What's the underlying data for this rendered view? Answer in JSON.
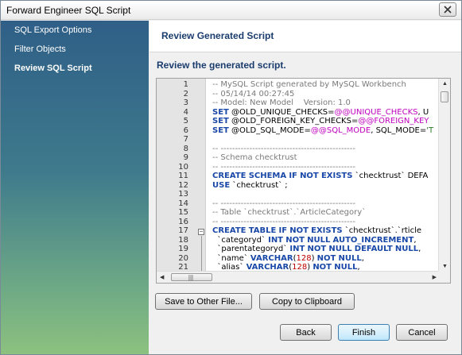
{
  "window": {
    "title": "Forward Engineer SQL Script"
  },
  "sidebar": {
    "items": [
      {
        "label": "SQL Export Options",
        "active": false
      },
      {
        "label": "Filter Objects",
        "active": false
      },
      {
        "label": "Review SQL Script",
        "active": true
      }
    ]
  },
  "main": {
    "page_title": "Review Generated Script",
    "subheading": "Review the generated script."
  },
  "editor": {
    "line_numbers": [
      "1",
      "2",
      "3",
      "4",
      "5",
      "6",
      "7",
      "8",
      "9",
      "10",
      "11",
      "12",
      "13",
      "14",
      "15",
      "16",
      "17",
      "18",
      "19",
      "20",
      "21"
    ],
    "lines": [
      "-- MySQL Script generated by MySQL Workbench",
      "-- 05/14/14 00:27:45",
      "-- Model: New Model    Version: 1.0",
      "SET @OLD_UNIQUE_CHECKS=@@UNIQUE_CHECKS, U",
      "SET @OLD_FOREIGN_KEY_CHECKS=@@FOREIGN_KEY",
      "SET @OLD_SQL_MODE=@@SQL_MODE, SQL_MODE='T",
      "",
      "-- -----------------------------------------------",
      "-- Schema checktrust",
      "-- -----------------------------------------------",
      "CREATE SCHEMA IF NOT EXISTS `checktrust` DEFA",
      "USE `checktrust` ;",
      "",
      "-- -----------------------------------------------",
      "-- Table `checktrust`.`ArticleCategory`",
      "-- -----------------------------------------------",
      "CREATE TABLE IF NOT EXISTS `checktrust`.`ArticleC",
      "  `categoryId` INT NOT NULL AUTO_INCREMENT,",
      "  `parentCategoryId` INT NOT NULL DEFAULT NULL,",
      "  `name` VARCHAR(128) NOT NULL,",
      "  `alias` VARCHAR(128) NOT NULL,"
    ],
    "scroll_grip": "|||"
  },
  "buttons": {
    "save_file": "Save to Other File...",
    "copy_clipboard": "Copy to Clipboard",
    "back": "Back",
    "finish": "Finish",
    "cancel": "Cancel"
  },
  "colors": {
    "keyword": "#1a48a8",
    "comment": "#7a7a7a",
    "variable": "#c000c0",
    "heading": "#1a3c6e"
  }
}
